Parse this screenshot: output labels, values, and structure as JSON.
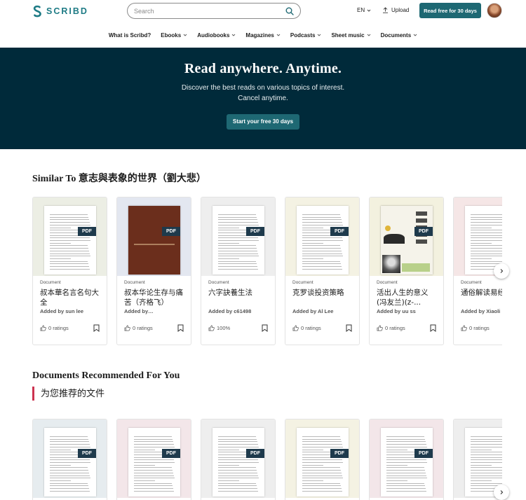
{
  "header": {
    "logo_text": "SCRIBD",
    "search_placeholder": "Search",
    "language": "EN",
    "upload_label": "Upload",
    "cta_label": "Read free for 30 days"
  },
  "nav": {
    "items": [
      {
        "label": "What is Scribd?",
        "caret": false
      },
      {
        "label": "Ebooks",
        "caret": true
      },
      {
        "label": "Audiobooks",
        "caret": true
      },
      {
        "label": "Magazines",
        "caret": true
      },
      {
        "label": "Podcasts",
        "caret": true
      },
      {
        "label": "Sheet music",
        "caret": true
      },
      {
        "label": "Documents",
        "caret": true
      }
    ]
  },
  "hero": {
    "title": "Read anywhere. Anytime.",
    "line1": "Discover the best reads on various topics of interest.",
    "line2": "Cancel anytime.",
    "button": "Start your free 30 days"
  },
  "similar": {
    "title": "Similar To 意志與表象的世界（劉大悲）",
    "cards": [
      {
        "type": "Document",
        "title": "叔本華名言名句大全",
        "author": "Added by sun lee",
        "rating": "0 ratings",
        "badge": "PDF",
        "bg": "#eceee4",
        "cover": "paper"
      },
      {
        "type": "Document",
        "title": "叔本华论生存与痛苦（齐格飞）",
        "author": "Added by…",
        "rating": "0 ratings",
        "badge": "PDF",
        "bg": "#e3e7f0",
        "cover": "brown-book"
      },
      {
        "type": "Document",
        "title": "六字訣養生法",
        "author": "Added by c61498",
        "rating": "100%",
        "badge": "PDF",
        "bg": "#eeeeee",
        "cover": "paper"
      },
      {
        "type": "Document",
        "title": "克罗谈投资策略",
        "author": "Added by Al Lee",
        "rating": "0 ratings",
        "badge": "PDF",
        "bg": "#f4f2e3",
        "cover": "paper"
      },
      {
        "type": "Document",
        "title": "活出人生的意义(冯友兰)(z-...",
        "author": "Added by uu ss",
        "rating": "0 ratings",
        "badge": "PDF",
        "bg": "#f3f1df",
        "cover": "photo-book"
      },
      {
        "type": "Document",
        "title": "通俗解读易经",
        "author": "Added by Xiaoli",
        "rating": "0 ratings",
        "badge": "",
        "bg": "#f5e6e6",
        "cover": "paper"
      }
    ]
  },
  "recommended": {
    "title": "Documents Recommended For You",
    "subtitle": "为您推荐的文件",
    "cards": [
      {
        "badge": "PDF",
        "bg": "#e6ecef"
      },
      {
        "badge": "PDF",
        "bg": "#f3e6e9"
      },
      {
        "badge": "PDF",
        "bg": "#eeeeee"
      },
      {
        "badge": "PDF",
        "bg": "#f4f2e3"
      },
      {
        "badge": "PDF",
        "bg": "#f3e6e9"
      },
      {
        "badge": "",
        "bg": "#eeeeee"
      }
    ]
  },
  "colors": {
    "brand": "#1e7b85",
    "cta": "#1e6873",
    "hero_bg": "#002a3a",
    "accent_bar": "#cc3350"
  }
}
